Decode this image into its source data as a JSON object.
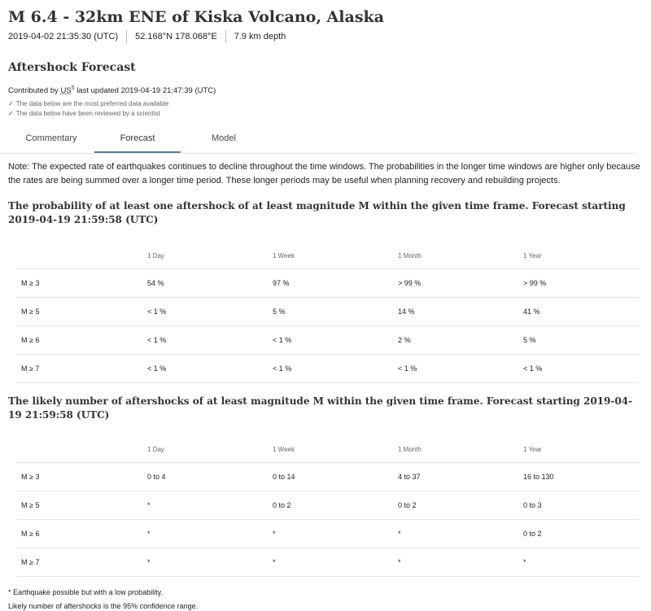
{
  "event": {
    "title": "M 6.4 - 32km ENE of Kiska Volcano, Alaska",
    "time": "2019-04-02 21:35:30 (UTC)",
    "coords": "52.168°N 178.068°E",
    "depth": "7.9 km depth"
  },
  "section": {
    "title": "Aftershock Forecast",
    "contributed_prefix": "Contributed by",
    "contributed_source": "US",
    "contributed_sup": "5",
    "last_updated": "last updated 2019-04-19 21:47:39 (UTC)",
    "checks": [
      "The data below are the most preferred data available",
      "The data below have been reviewed by a scientist"
    ]
  },
  "tabs": [
    "Commentary",
    "Forecast",
    "Model"
  ],
  "note": "Note: The expected rate of earthquakes continues to decline throughout the time windows. The probabilities in the longer time windows are higher only because the rates are being summed over a longer time period. These longer periods may be useful when planning recovery and rebuilding projects.",
  "table1": {
    "title": "The probability of at least one aftershock of at least magnitude M within the given time frame. Forecast starting 2019-04-19 21:59:58 (UTC)",
    "headers": [
      "",
      "1 Day",
      "1 Week",
      "1 Month",
      "1 Year"
    ],
    "rows": [
      [
        "M ≥ 3",
        "54 %",
        "97 %",
        "> 99 %",
        "> 99 %"
      ],
      [
        "M ≥ 5",
        "< 1 %",
        "5 %",
        "14 %",
        "41 %"
      ],
      [
        "M ≥ 6",
        "< 1 %",
        "< 1 %",
        "2 %",
        "5 %"
      ],
      [
        "M ≥ 7",
        "< 1 %",
        "< 1 %",
        "< 1 %",
        "< 1 %"
      ]
    ]
  },
  "table2": {
    "title": "The likely number of aftershocks of at least magnitude M within the given time frame. Forecast starting 2019-04-19 21:59:58 (UTC)",
    "headers": [
      "",
      "1 Day",
      "1 Week",
      "1 Month",
      "1 Year"
    ],
    "rows": [
      [
        "M ≥ 3",
        "0 to 4",
        "0 to 14",
        "4 to 37",
        "16 to 130"
      ],
      [
        "M ≥ 5",
        "*",
        "0 to 2",
        "0 to 2",
        "0 to 3"
      ],
      [
        "M ≥ 6",
        "*",
        "*",
        "*",
        "0 to 2"
      ],
      [
        "M ≥ 7",
        "*",
        "*",
        "*",
        "*"
      ]
    ]
  },
  "footnotes": [
    "* Earthquake possible but with a low probability.",
    "Likely number of aftershocks is the 95% confidence range."
  ]
}
